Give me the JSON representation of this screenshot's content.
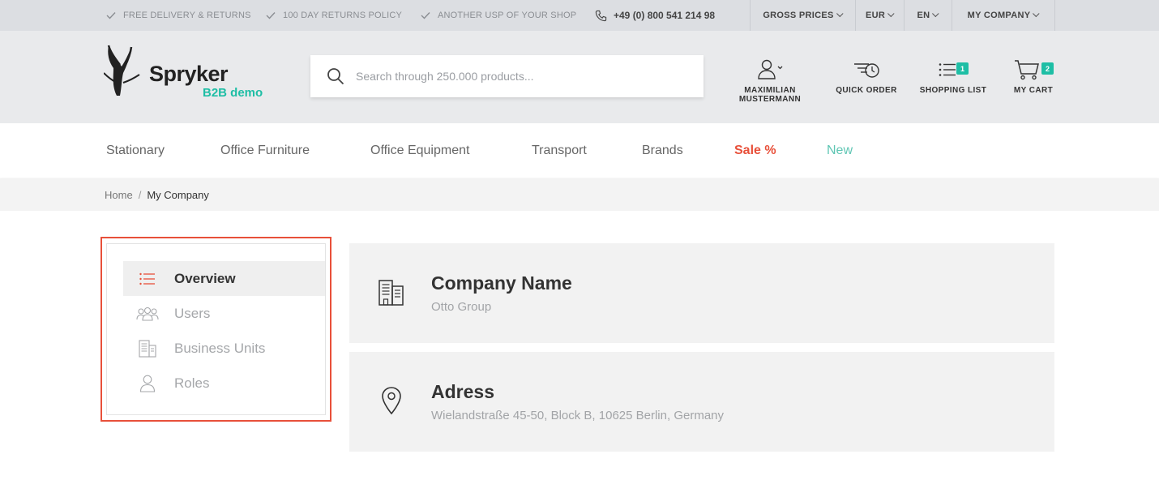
{
  "topbar": {
    "usps": [
      "FREE DELIVERY & RETURNS",
      "100 DAY RETURNS POLICY",
      "ANOTHER USP OF YOUR SHOP"
    ],
    "phone": "+49 (0) 800 541 214 98",
    "selectors": {
      "price_mode": "GROSS PRICES",
      "currency": "EUR",
      "language": "EN",
      "company": "MY COMPANY"
    }
  },
  "header": {
    "logo_word": "Spryker",
    "logo_sub": "B2B demo",
    "search_placeholder": "Search through 250.000 products...",
    "user_name": "MAXIMILIAN MUSTERMANN",
    "quick_order": "QUICK ORDER",
    "shopping_list": "SHOPPING LIST",
    "shopping_list_count": "1",
    "cart": "MY CART",
    "cart_count": "2"
  },
  "nav": {
    "items": [
      "Stationary",
      "Office Furniture",
      "Office Equipment",
      "Transport",
      "Brands",
      "Sale %",
      "New"
    ]
  },
  "breadcrumb": {
    "home": "Home",
    "separator": "/",
    "current": "My Company"
  },
  "sidebar": {
    "items": [
      {
        "label": "Overview",
        "icon": "list-icon",
        "active": true
      },
      {
        "label": "Users",
        "icon": "users-icon",
        "active": false
      },
      {
        "label": "Business Units",
        "icon": "building-icon",
        "active": false
      },
      {
        "label": "Roles",
        "icon": "user-icon",
        "active": false
      }
    ]
  },
  "company": {
    "name_title": "Company Name",
    "name_value": "Otto Group",
    "address_title": "Adress",
    "address_value": "Wielandstraße 45-50, Block B, 10625 Berlin, Germany"
  },
  "colors": {
    "accent_red": "#e8503a",
    "accent_teal": "#1ebea5",
    "topbar_bg": "#dcdee2",
    "header_bg": "#e9eaec"
  }
}
